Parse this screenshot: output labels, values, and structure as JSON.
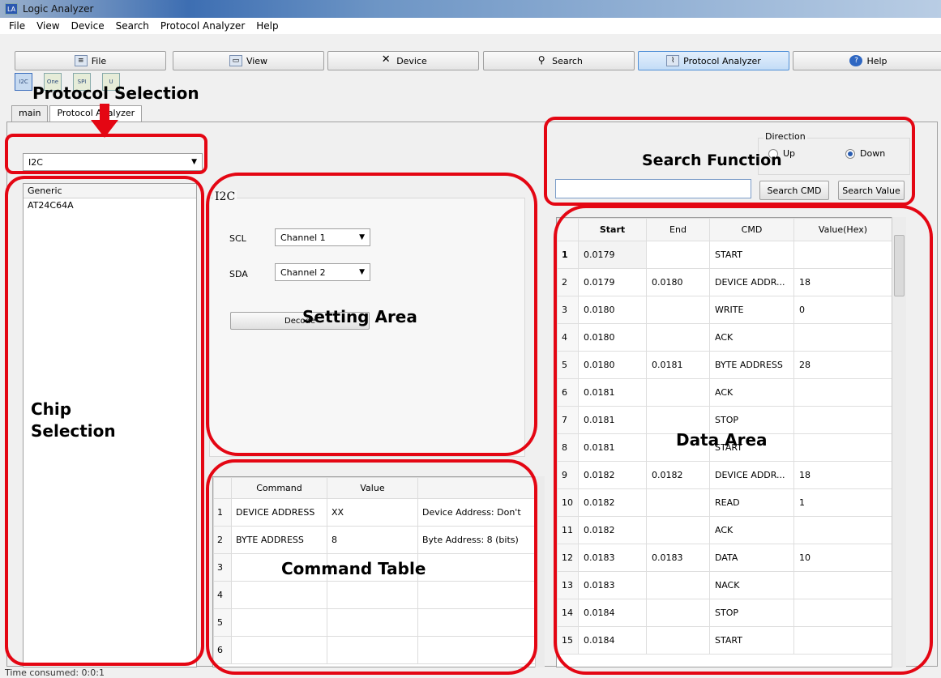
{
  "window": {
    "title": "Logic Analyzer",
    "app_icon": "LA"
  },
  "menu": [
    "File",
    "View",
    "Device",
    "Search",
    "Protocol Analyzer",
    "Help"
  ],
  "toolbar": [
    {
      "label": "File",
      "icon": "file-icon"
    },
    {
      "label": "View",
      "icon": "view-icon"
    },
    {
      "label": "Device",
      "icon": "tools-icon"
    },
    {
      "label": "Search",
      "icon": "magnifier-icon"
    },
    {
      "label": "Protocol Analyzer",
      "icon": "protocol-analyzer-icon",
      "active": true
    },
    {
      "label": "Help",
      "icon": "help-icon"
    }
  ],
  "protocol_icons": [
    "I2C",
    "One",
    "SPI",
    "U"
  ],
  "tabs": [
    "main",
    "Protocol Analyzer"
  ],
  "protocol_select": {
    "value": "I2C"
  },
  "chip_list": {
    "header": "Generic",
    "items": [
      "AT24C64A"
    ]
  },
  "settings": {
    "group_title": "I2C",
    "scl_label": "SCL",
    "scl_value": "Channel 1",
    "sda_label": "SDA",
    "sda_value": "Channel 2",
    "decode_label": "Decode"
  },
  "command_table": {
    "headers": [
      "Command",
      "Value",
      ""
    ],
    "rows": [
      [
        "1",
        "DEVICE ADDRESS",
        "XX",
        "Device Address: Don't"
      ],
      [
        "2",
        "BYTE ADDRESS",
        "8",
        "Byte Address: 8 (bits)"
      ],
      [
        "3",
        "",
        "",
        ""
      ],
      [
        "4",
        "",
        "",
        ""
      ],
      [
        "5",
        "",
        "",
        ""
      ],
      [
        "6",
        "",
        "",
        ""
      ]
    ]
  },
  "search": {
    "direction_label": "Direction",
    "up_label": "Up",
    "down_label": "Down",
    "selected": "Down",
    "input_value": "",
    "cmd_button": "Search CMD",
    "value_button": "Search Value"
  },
  "data_table": {
    "headers": [
      "Start",
      "End",
      "CMD",
      "Value(Hex)"
    ],
    "rows": [
      [
        "1",
        "0.0179",
        "",
        "START",
        ""
      ],
      [
        "2",
        "0.0179",
        "0.0180",
        "DEVICE ADDR...",
        "18"
      ],
      [
        "3",
        "0.0180",
        "",
        "WRITE",
        "0"
      ],
      [
        "4",
        "0.0180",
        "",
        "ACK",
        ""
      ],
      [
        "5",
        "0.0180",
        "0.0181",
        "BYTE ADDRESS",
        "28"
      ],
      [
        "6",
        "0.0181",
        "",
        "ACK",
        ""
      ],
      [
        "7",
        "0.0181",
        "",
        "STOP",
        ""
      ],
      [
        "8",
        "0.0181",
        "",
        "START",
        ""
      ],
      [
        "9",
        "0.0182",
        "0.0182",
        "DEVICE ADDR...",
        "18"
      ],
      [
        "10",
        "0.0182",
        "",
        "READ",
        "1"
      ],
      [
        "11",
        "0.0182",
        "",
        "ACK",
        ""
      ],
      [
        "12",
        "0.0183",
        "0.0183",
        "DATA",
        "10"
      ],
      [
        "13",
        "0.0183",
        "",
        "NACK",
        ""
      ],
      [
        "14",
        "0.0184",
        "",
        "STOP",
        ""
      ],
      [
        "15",
        "0.0184",
        "",
        "START",
        ""
      ]
    ]
  },
  "annotations": {
    "protocol_selection": "Protocol Selection",
    "search_function": "Search Function",
    "setting_area": "Setting Area",
    "chip_selection_1": "Chip",
    "chip_selection_2": "Selection",
    "data_area": "Data Area",
    "command_table": "Command Table",
    "ring_color": "#e40613"
  },
  "status": "Time consumed: 0:0:1"
}
